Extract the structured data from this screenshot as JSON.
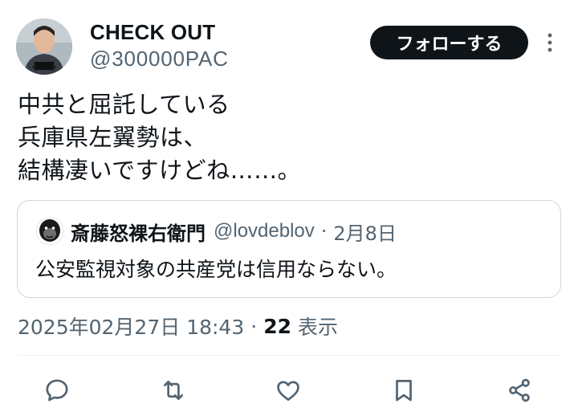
{
  "author": {
    "display_name": "CHECK OUT",
    "handle": "@300000PAC"
  },
  "follow_button": {
    "label": "フォローする"
  },
  "tweet": {
    "text": "中共と屈託している\n兵庫県左翼勢は、\n結構凄いですけどね……。"
  },
  "quoted_tweet": {
    "display_name": "斎藤怒裸右衛門",
    "handle": "@lovdeblov",
    "separator": "·",
    "date": "2月8日",
    "text": "公安監視対象の共産党は信用ならない。"
  },
  "meta": {
    "timestamp": "2025年02月27日 18:43",
    "separator": "·",
    "views_count": "22",
    "views_label": "表示"
  },
  "actions": {
    "icons": [
      "reply-icon",
      "retweet-icon",
      "like-icon",
      "bookmark-icon",
      "share-icon"
    ]
  },
  "colors": {
    "text_primary": "#0f1419",
    "text_secondary": "#536471",
    "button_dark": "#0f1419",
    "border": "#cfd9de"
  }
}
